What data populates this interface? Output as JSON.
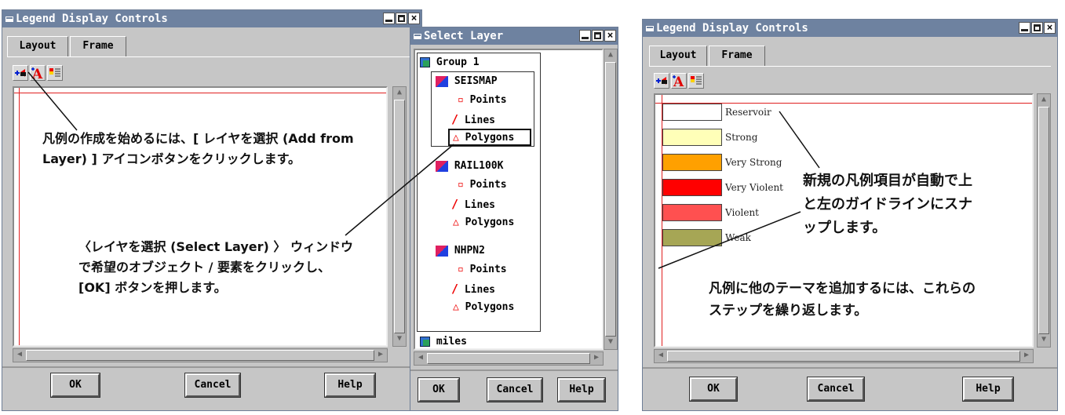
{
  "win1": {
    "title": "Legend Display Controls",
    "tabs": [
      "Layout",
      "Frame"
    ],
    "buttons": {
      "ok": "OK",
      "cancel": "Cancel",
      "help": "Help"
    },
    "callout1": "凡例の作成を始めるには、[ レイヤを選択 (Add from Layer) ] アイコンボタンをクリックします。",
    "callout2": "〈レイヤを選択 (Select Layer) 〉 ウィンドウで希望のオブジェクト / 要素をクリックし、[OK] ボタンを押します。"
  },
  "win2": {
    "title": "Select Layer",
    "tree": {
      "group": "Group 1",
      "layers": [
        {
          "name": "SEISMAP",
          "items": [
            "Points",
            "Lines",
            "Polygons"
          ]
        },
        {
          "name": "RAIL100K",
          "items": [
            "Points",
            "Lines",
            "Polygons"
          ]
        },
        {
          "name": "NHPN2",
          "items": [
            "Points",
            "Lines",
            "Polygons"
          ]
        }
      ],
      "other": "miles"
    },
    "buttons": {
      "ok": "OK",
      "cancel": "Cancel",
      "help": "Help"
    }
  },
  "win3": {
    "title": "Legend Display Controls",
    "tabs": [
      "Layout",
      "Frame"
    ],
    "legend": [
      {
        "label": "Reservoir",
        "color": "#ffffff"
      },
      {
        "label": "Strong",
        "color": "#ffffb8"
      },
      {
        "label": "Very Strong",
        "color": "#ffa000"
      },
      {
        "label": "Very Violent",
        "color": "#ff0000"
      },
      {
        "label": "Violent",
        "color": "#ff5050"
      },
      {
        "label": "Weak",
        "color": "#a6a655"
      }
    ],
    "buttons": {
      "ok": "OK",
      "cancel": "Cancel",
      "help": "Help"
    },
    "callout1": "新規の凡例項目が自動で上と左のガイドラインにスナップします。",
    "callout2": "凡例に他のテーマを追加するには、これらのステップを繰り返します。"
  },
  "colors": {
    "titlebar": "#6e82a0",
    "panel": "#c6c6c6",
    "guide": "#e02020"
  }
}
